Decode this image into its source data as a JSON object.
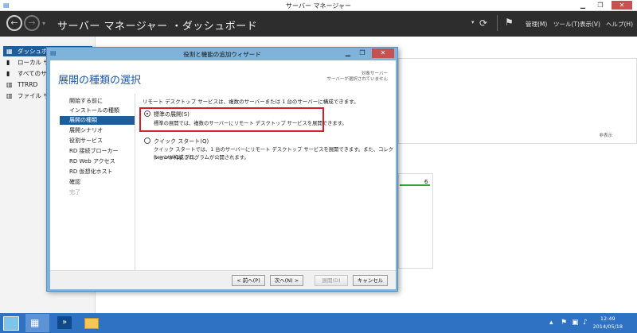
{
  "window": {
    "title": "サーバー マネージャー",
    "min": "▁",
    "max": "❐",
    "close": "✕"
  },
  "header": {
    "title": "サーバー マネージャー ・ダッシュボード",
    "back_icon": "back-arrow-icon",
    "forward_icon": "forward-arrow-icon",
    "menus": [
      "管理(M)",
      "ツール(T)",
      "表示(V)",
      "ヘルプ(H)"
    ]
  },
  "sidebar": {
    "items": [
      {
        "label": "ダッシュボ",
        "icon": "dashboard-icon",
        "selected": true
      },
      {
        "label": "ローカル サ",
        "icon": "server-icon",
        "selected": false
      },
      {
        "label": "すべてのサ",
        "icon": "servers-icon",
        "selected": false
      },
      {
        "label": "TTRRD",
        "icon": "role-icon",
        "selected": false
      },
      {
        "label": "ファイル サ",
        "icon": "file-server-icon",
        "selected": false
      }
    ]
  },
  "dialog": {
    "title": "役割と機能の追加ウィザード",
    "heading": "展開の種類の選択",
    "target_label": "対象サーバー",
    "target_value": "サーバーが選択されていません",
    "steps": [
      {
        "label": "開始する前に",
        "state": "normal"
      },
      {
        "label": "インストールの種類",
        "state": "normal"
      },
      {
        "label": "展開の種類",
        "state": "active"
      },
      {
        "label": "展開シナリオ",
        "state": "normal"
      },
      {
        "label": "役割サービス",
        "state": "normal"
      },
      {
        "label": "RD 接続ブローカー",
        "state": "normal"
      },
      {
        "label": "RD Web アクセス",
        "state": "normal"
      },
      {
        "label": "RD 仮想化ホスト",
        "state": "normal"
      },
      {
        "label": "確認",
        "state": "normal"
      },
      {
        "label": "完了",
        "state": "disabled"
      }
    ],
    "intro": "リモート デスクトップ サービスは、複数のサーバーまたは 1 台のサーバーに構成できます。",
    "options": [
      {
        "label": "標準の展開(S)",
        "desc": "標準の展開では、複数のサーバーにリモート デスクトップ サービスを展開できます。",
        "selected": true
      },
      {
        "label": "クイック スタート(Q)",
        "desc_line1": "クイック スタートでは、1 台のサーバーにリモート デスクトップ サービスを展開できます。また、コレクションが作成され、",
        "desc_line2": "RemoteApp プログラムが公開されます。",
        "selected": false
      }
    ],
    "buttons": {
      "prev": "< 前へ(P)",
      "next": "次へ(N) >",
      "deploy": "展開(D)",
      "cancel": "キャンセル"
    }
  },
  "background": {
    "hide_label": "非表示",
    "tile_count": "6"
  },
  "taskbar": {
    "time": "12:49",
    "date": "2014/05/18"
  }
}
